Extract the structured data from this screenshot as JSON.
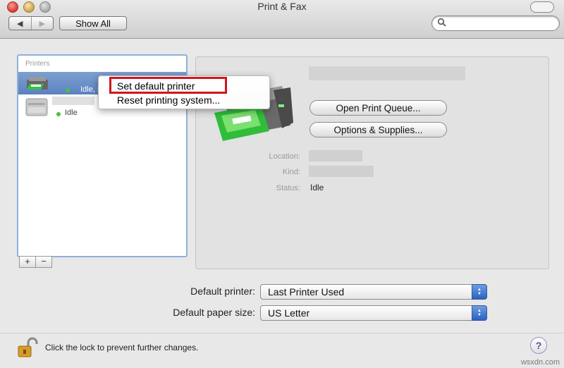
{
  "window": {
    "title": "Print & Fax"
  },
  "toolbar": {
    "back_icon": "back-arrow-icon",
    "forward_icon": "forward-arrow-icon",
    "show_all_label": "Show All",
    "search_placeholder": ""
  },
  "printers_list": {
    "header": "Printers",
    "items": [
      {
        "status": "Idle, La",
        "selected": true
      },
      {
        "status": "Idle",
        "selected": false
      }
    ],
    "add_label": "+",
    "remove_label": "−"
  },
  "context_menu": {
    "items": [
      {
        "label": "Set default printer",
        "highlighted": true
      },
      {
        "label": "Reset printing system..."
      }
    ],
    "highlight_color": "#d0161e"
  },
  "details": {
    "open_queue_label": "Open Print Queue...",
    "options_label": "Options & Supplies...",
    "location_label": "Location:",
    "kind_label": "Kind:",
    "status_label": "Status:",
    "status_value": "Idle"
  },
  "defaults": {
    "default_printer_label": "Default printer:",
    "default_printer_value": "Last Printer Used",
    "paper_size_label": "Default paper size:",
    "paper_size_value": "US Letter"
  },
  "footer": {
    "lock_text": "Click the lock to prevent further changes.",
    "help_label": "?",
    "watermark": "wsxdn.com"
  },
  "colors": {
    "selection": "#5b82c0",
    "list_border": "#8fb1d9",
    "status_green": "#48c13c"
  }
}
